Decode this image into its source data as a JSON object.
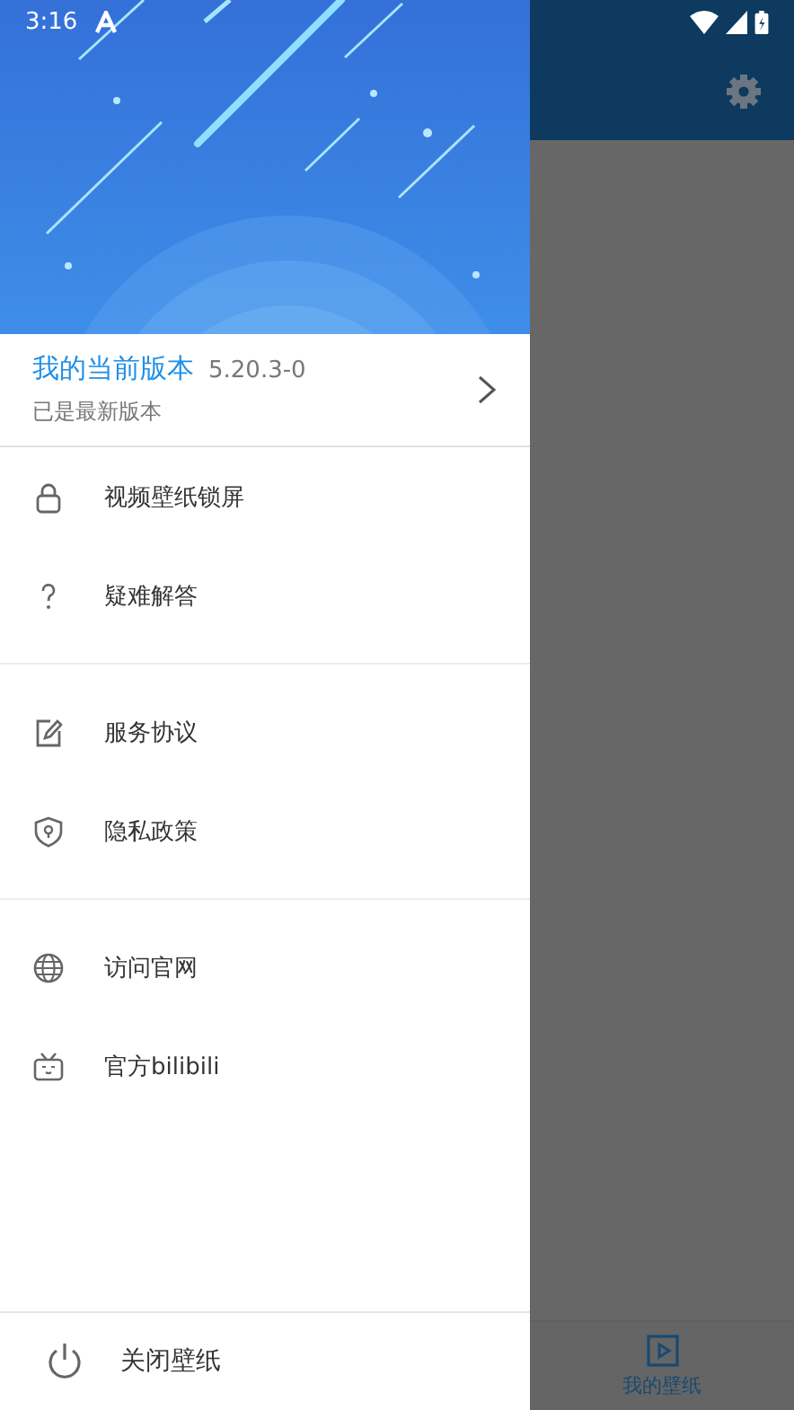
{
  "status_bar": {
    "time": "3:16"
  },
  "toolbar": {
    "settings": true
  },
  "version_card": {
    "title": "我的当前版本",
    "version": "5.20.3-0",
    "status": "已是最新版本"
  },
  "menu_groups": [
    {
      "items": [
        {
          "kind": "lock",
          "label": "视频壁纸锁屏"
        },
        {
          "kind": "help",
          "label": "疑难解答"
        }
      ]
    },
    {
      "items": [
        {
          "kind": "edit",
          "label": "服务协议"
        },
        {
          "kind": "shield",
          "label": "隐私政策"
        }
      ]
    },
    {
      "items": [
        {
          "kind": "globe",
          "label": "访问官网"
        },
        {
          "kind": "tv",
          "label": "官方bilibili"
        }
      ]
    }
  ],
  "close_item": {
    "label": "关闭壁纸"
  },
  "bottom_nav": [
    {
      "label": "我的壁纸",
      "selected": true
    }
  ]
}
